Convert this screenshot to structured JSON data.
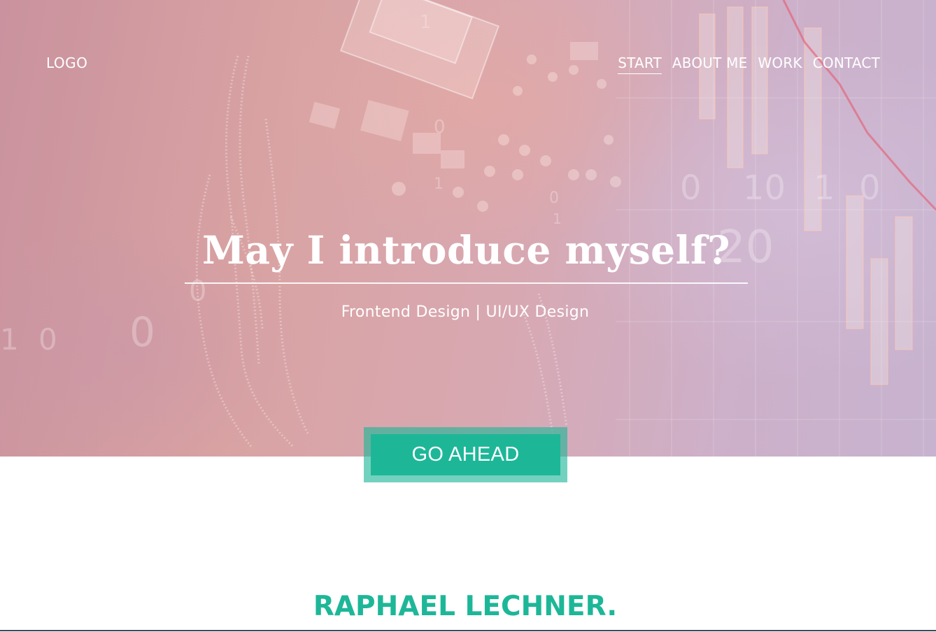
{
  "header": {
    "logo": "LOGO",
    "nav": [
      {
        "label": "START",
        "active": true
      },
      {
        "label": "ABOUT ME",
        "active": false
      },
      {
        "label": "WORK",
        "active": false
      },
      {
        "label": "CONTACT",
        "active": false
      }
    ]
  },
  "hero": {
    "headline": "May I introduce myself?",
    "subtitle": "Frontend Design | UI/UX Design",
    "cta_label": "GO AHEAD"
  },
  "about": {
    "name": "RAPHAEL LECHNER."
  },
  "colors": {
    "accent": "#1db798",
    "hero_tint": "#d8a8b1",
    "text_on_hero": "#ffffff"
  }
}
